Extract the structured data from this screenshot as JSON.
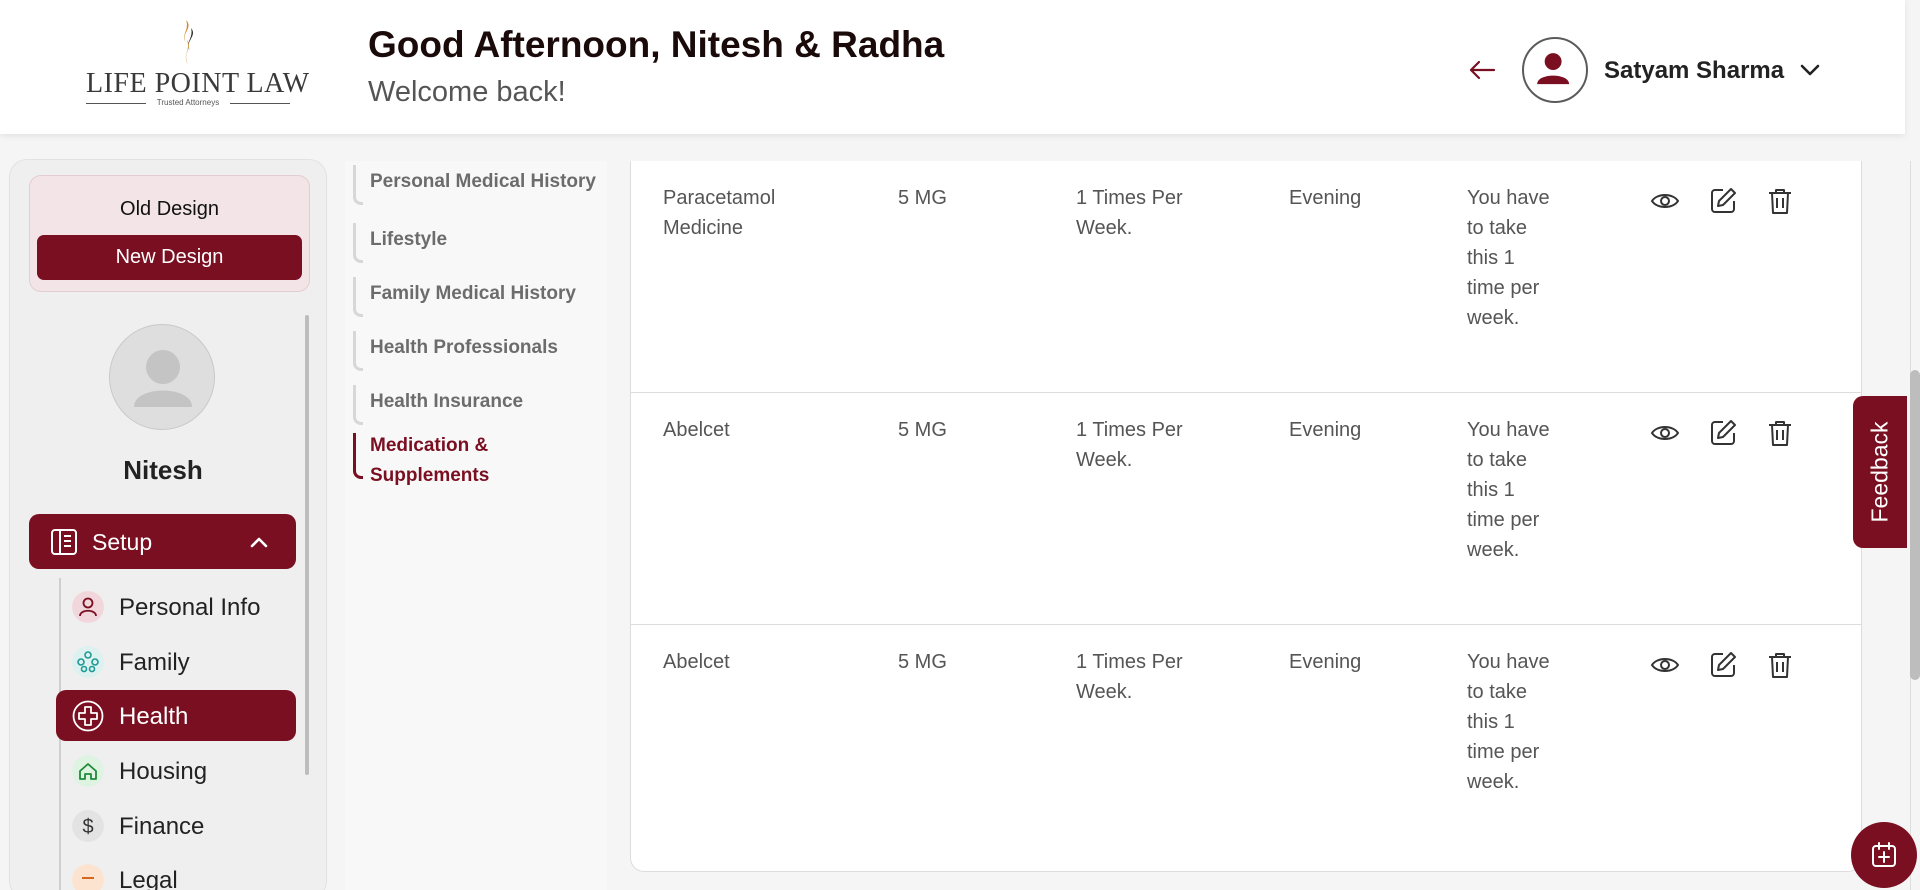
{
  "brand": {
    "name": "LIFE POINT LAW",
    "tagline": "Trusted Attorneys"
  },
  "header": {
    "greeting": "Good Afternoon, Nitesh & Radha",
    "subtitle": "Welcome back!",
    "user_name": "Satyam Sharma"
  },
  "sidebar": {
    "old_design": "Old Design",
    "new_design": "New Design",
    "profile_name": "Nitesh",
    "setup_label": "Setup",
    "items": [
      {
        "label": "Personal Info",
        "icon": "person-icon"
      },
      {
        "label": "Family",
        "icon": "family-icon"
      },
      {
        "label": "Health",
        "icon": "health-cross-icon",
        "active": true
      },
      {
        "label": "Housing",
        "icon": "home-icon"
      },
      {
        "label": "Finance",
        "icon": "dollar-icon"
      },
      {
        "label": "Legal",
        "icon": "legal-icon"
      }
    ]
  },
  "sections": [
    {
      "label": "Personal Medical History"
    },
    {
      "label": "Lifestyle"
    },
    {
      "label": "Family Medical History"
    },
    {
      "label": "Health Professionals"
    },
    {
      "label": "Health Insurance"
    },
    {
      "label": "Medication & Supplements",
      "active": true
    }
  ],
  "medications": [
    {
      "name": "Paracetamol Medicine",
      "dose": "5 MG",
      "frequency": "1 Times Per Week.",
      "time": "Evening",
      "note": "You have to take this 1 time per week."
    },
    {
      "name": "Abelcet",
      "dose": "5 MG",
      "frequency": "1 Times Per Week.",
      "time": "Evening",
      "note": "You have to take this 1 time per week."
    },
    {
      "name": "Abelcet",
      "dose": "5 MG",
      "frequency": "1 Times Per Week.",
      "time": "Evening",
      "note": "You have to take this 1 time per week."
    }
  ],
  "feedback_label": "Feedback",
  "colors": {
    "brand": "#7a0f22",
    "active_nav": "#7a0f22",
    "muted_text": "#6c6c6c"
  }
}
